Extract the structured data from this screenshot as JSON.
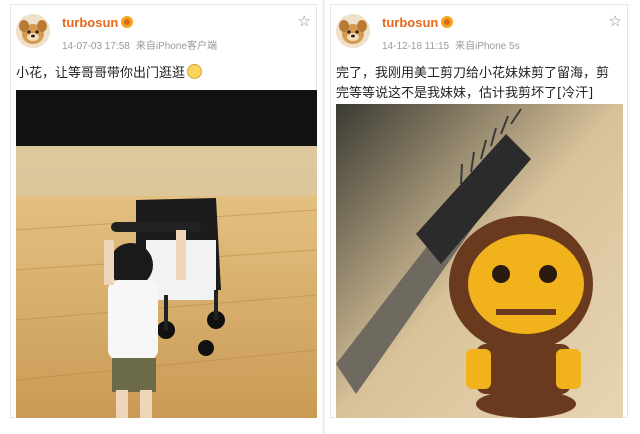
{
  "posts": [
    {
      "username": "turbosun",
      "date": "14-07-03 17:58",
      "source": "来自iPhone客户端",
      "text": "小花，让等哥哥带你出门逛逛",
      "photo_icon": "photo-toddler-stroller"
    },
    {
      "username": "turbosun",
      "date": "14-12-18 11:15",
      "source": "来自iPhone 5s",
      "text": "完了，我刚用美工剪刀给小花妹妹剪了留海，剪完等等说这不是我妹妹，估计我剪坏了[冷汗]",
      "photo_icon": "photo-comb-monkey-figure"
    }
  ],
  "icons": {
    "favorite": "star-outline-icon",
    "verified": "verified-badge-icon",
    "emoticon": "smile-emoticon-icon"
  },
  "colors": {
    "username": "#e66a1f",
    "meta": "#9a9a9a",
    "text": "#222222"
  }
}
